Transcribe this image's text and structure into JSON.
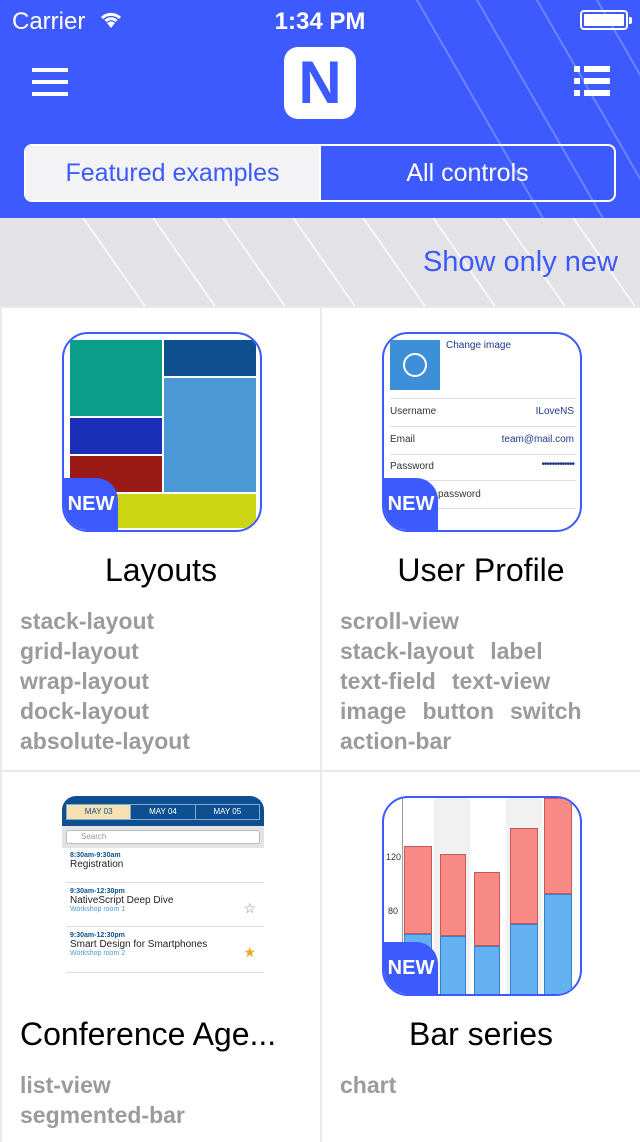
{
  "status_bar": {
    "carrier": "Carrier",
    "time": "1:34 PM"
  },
  "header": {
    "logo_letter": "N",
    "logo_braces": "{ }"
  },
  "segmented": {
    "featured": "Featured examples",
    "all": "All controls",
    "selected": "Featured examples"
  },
  "filter": {
    "show_new": "Show only new"
  },
  "colors": {
    "accent": "#3d5afe",
    "tag_text": "#9b9b9b"
  },
  "cards": [
    {
      "title": "Layouts",
      "new": "NEW",
      "tags": [
        "stack-layout",
        "grid-layout",
        "wrap-layout",
        "dock-layout",
        "absolute-layout"
      ]
    },
    {
      "title": "User Profile",
      "new": "NEW",
      "tags": [
        "scroll-view",
        "stack-layout",
        "label",
        "text-field",
        "text-view",
        "image",
        "button",
        "switch",
        "action-bar"
      ],
      "preview": {
        "change_image": "Change image",
        "username_label": "Username",
        "username_value": "ILoveNS",
        "email_label": "Email",
        "email_value": "team@mail.com",
        "password_label": "Password",
        "password_value": "•••••••••••••",
        "password_hint": "password"
      }
    },
    {
      "title": "Conference Age...",
      "tags": [
        "list-view",
        "segmented-bar"
      ],
      "preview": {
        "tabs": [
          "MAY 03",
          "MAY 04",
          "MAY 05"
        ],
        "search": "Search",
        "sessions": [
          {
            "time": "8:30am-9:30am",
            "name": "Registration",
            "room": ""
          },
          {
            "time": "9:30am-12:30pm",
            "name": "NativeScript Deep Dive",
            "room": "Workshop room 1"
          },
          {
            "time": "9:30am-12:30pm",
            "name": "Smart Design for Smartphones",
            "room": "Workshop room 2"
          }
        ]
      }
    },
    {
      "title": "Bar series",
      "new": "NEW",
      "tags": [
        "chart"
      ],
      "preview": {
        "y_ticks": [
          "120",
          "80"
        ]
      }
    }
  ]
}
